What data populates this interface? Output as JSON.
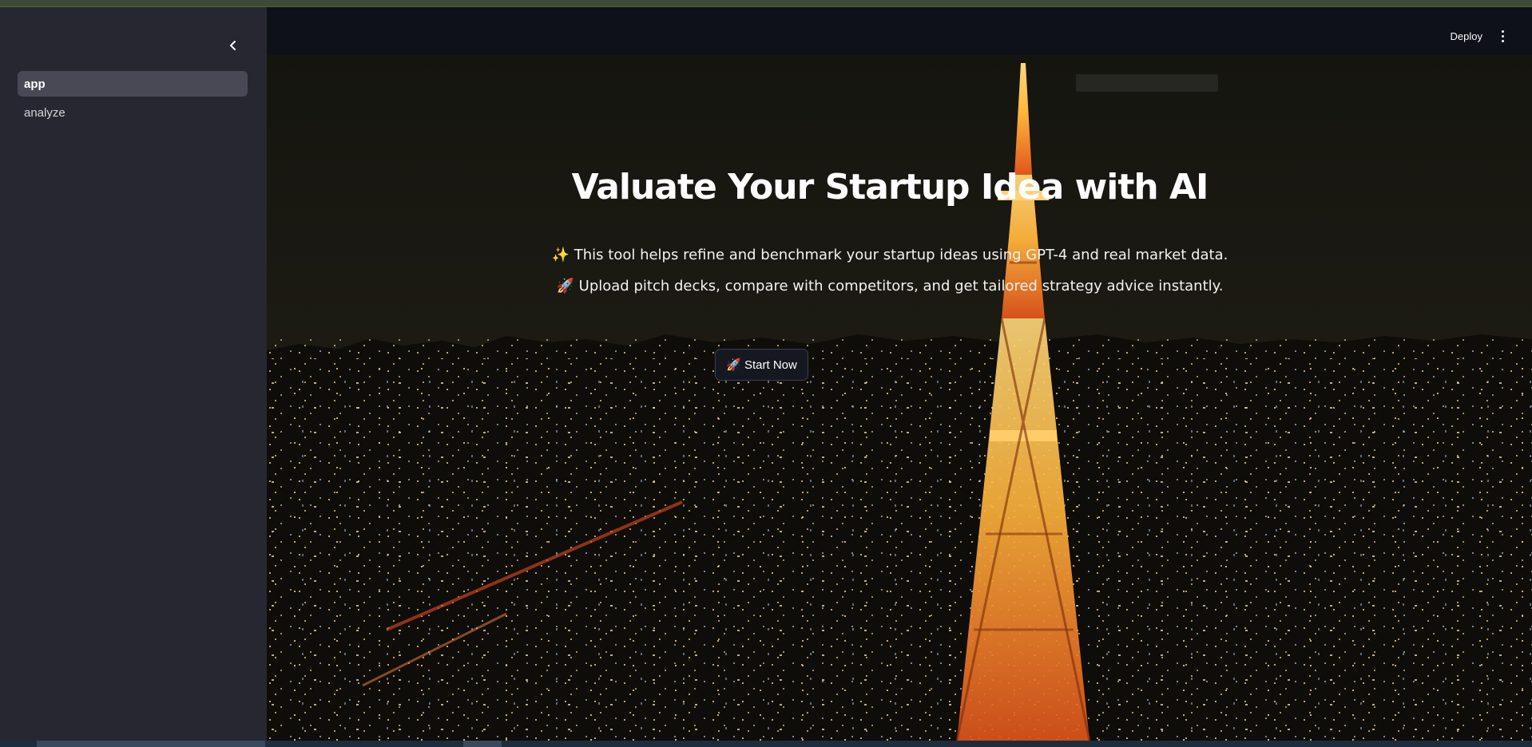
{
  "sidebar": {
    "collapse_icon": "chevron-left-icon",
    "items": [
      {
        "label": "app",
        "active": true
      },
      {
        "label": "analyze",
        "active": false
      }
    ]
  },
  "header": {
    "deploy_label": "Deploy",
    "menu_icon": "more-vertical-icon"
  },
  "hero": {
    "title": "Valuate Your Startup Idea with AI",
    "line1": "✨ This tool helps refine and benchmark your startup ideas using GPT-4 and real market data.",
    "line2": "🚀 Upload pitch decks, compare with competitors, and get tailored strategy advice instantly.",
    "button_label": "🚀 Start Now",
    "background_image": "night city skyline with illuminated tower"
  },
  "colors": {
    "sidebar_bg": "#262730",
    "main_bg": "#0e1117",
    "active_item_bg": "#484955",
    "tower_orange": "#ff9a2a"
  }
}
